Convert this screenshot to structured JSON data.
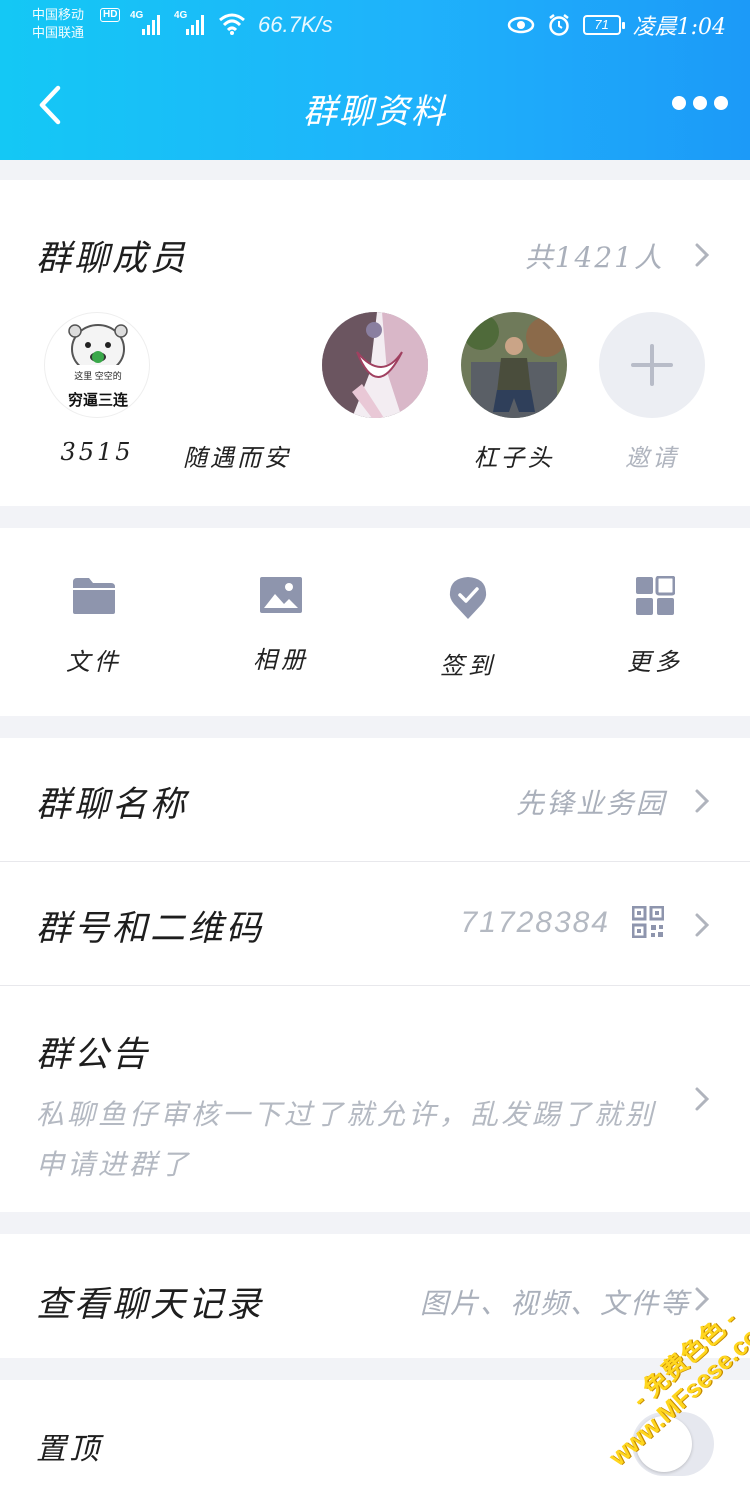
{
  "status_bar": {
    "carrier_1": "中国移动",
    "carrier_2": "中国联通",
    "hd": "HD",
    "net_1": "4G",
    "net_2": "4G",
    "speed": "66.7K/s",
    "battery": "71",
    "time": "凌晨1:04"
  },
  "header": {
    "title": "群聊资料"
  },
  "members_section": {
    "label": "群聊成员",
    "count": "共1421人",
    "members": [
      {
        "name": "3515",
        "avatar_caption_small": "这里 空空的",
        "avatar_caption": "穷逼三连"
      },
      {
        "name": "随遇而安"
      },
      {
        "name": ""
      },
      {
        "name": "杠子头"
      }
    ],
    "invite_label": "邀请"
  },
  "tools": [
    {
      "label": "文件",
      "icon": "folder-icon"
    },
    {
      "label": "相册",
      "icon": "image-icon"
    },
    {
      "label": "签到",
      "icon": "checkin-icon"
    },
    {
      "label": "更多",
      "icon": "grid-icon"
    }
  ],
  "group_name": {
    "label": "群聊名称",
    "value": "先锋业务园"
  },
  "group_number": {
    "label": "群号和二维码",
    "value": "71728384"
  },
  "announcement": {
    "label": "群公告",
    "text": "私聊鱼仔审核一下过了就允许，乱发踢了就别申请进群了"
  },
  "chat_history": {
    "label": "查看聊天记录",
    "value": "图片、视频、文件等"
  },
  "pin": {
    "label": "置顶",
    "enabled": false
  },
  "watermark": {
    "line1": "- 免费色色 -",
    "line2": "www.MFsese.com"
  },
  "colors": {
    "header_start": "#14c8f5",
    "header_end": "#1c9af8",
    "icon_gray": "#8e95ad",
    "secondary_text": "#aab0bb"
  }
}
